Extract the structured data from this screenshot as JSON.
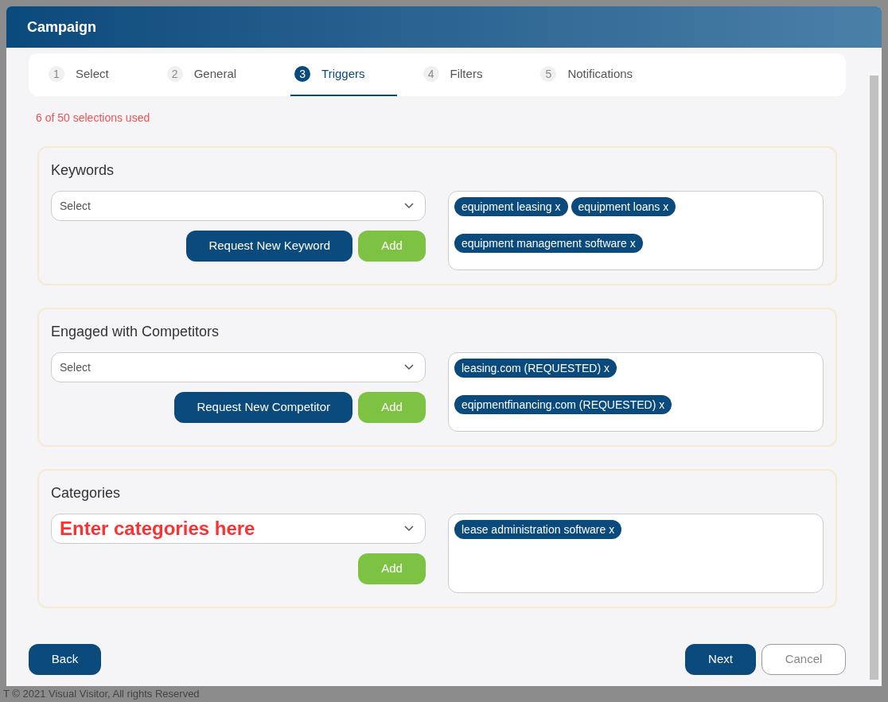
{
  "window": {
    "title": "Campaign"
  },
  "tabs": [
    {
      "number": "1",
      "label": "Select",
      "selected": false
    },
    {
      "number": "2",
      "label": "General",
      "selected": false
    },
    {
      "number": "3",
      "label": "Triggers",
      "selected": true
    },
    {
      "number": "4",
      "label": "Filters",
      "selected": false
    },
    {
      "number": "5",
      "label": "Notifications",
      "selected": false
    }
  ],
  "usage_note": "6 of 50 selections used",
  "sections": [
    {
      "title": "Keywords",
      "select": {
        "placeholder": "Select"
      },
      "request_button": "Request New Keyword",
      "add_button": "Add",
      "tags": [
        "equipment leasing x",
        "equipment loans x",
        "equipment management software x"
      ]
    },
    {
      "title": "Engaged with Competitors",
      "select": {
        "placeholder": "Select"
      },
      "request_button": "Request New Competitor",
      "add_button": "Add",
      "tags": [
        "leasing.com (REQUESTED) x",
        "eqipmentfinancing.com (REQUESTED) x"
      ]
    },
    {
      "title": "Categories",
      "select": {
        "annotation": "Enter categories here"
      },
      "add_button": "Add",
      "tags": [
        "lease administration software x"
      ]
    }
  ],
  "footer": {
    "back_button": "Back",
    "next_button": "Next",
    "cancel_button": "Cancel"
  },
  "page_footer": "T © 2021 Visual Visitor, All rights Reserved"
}
